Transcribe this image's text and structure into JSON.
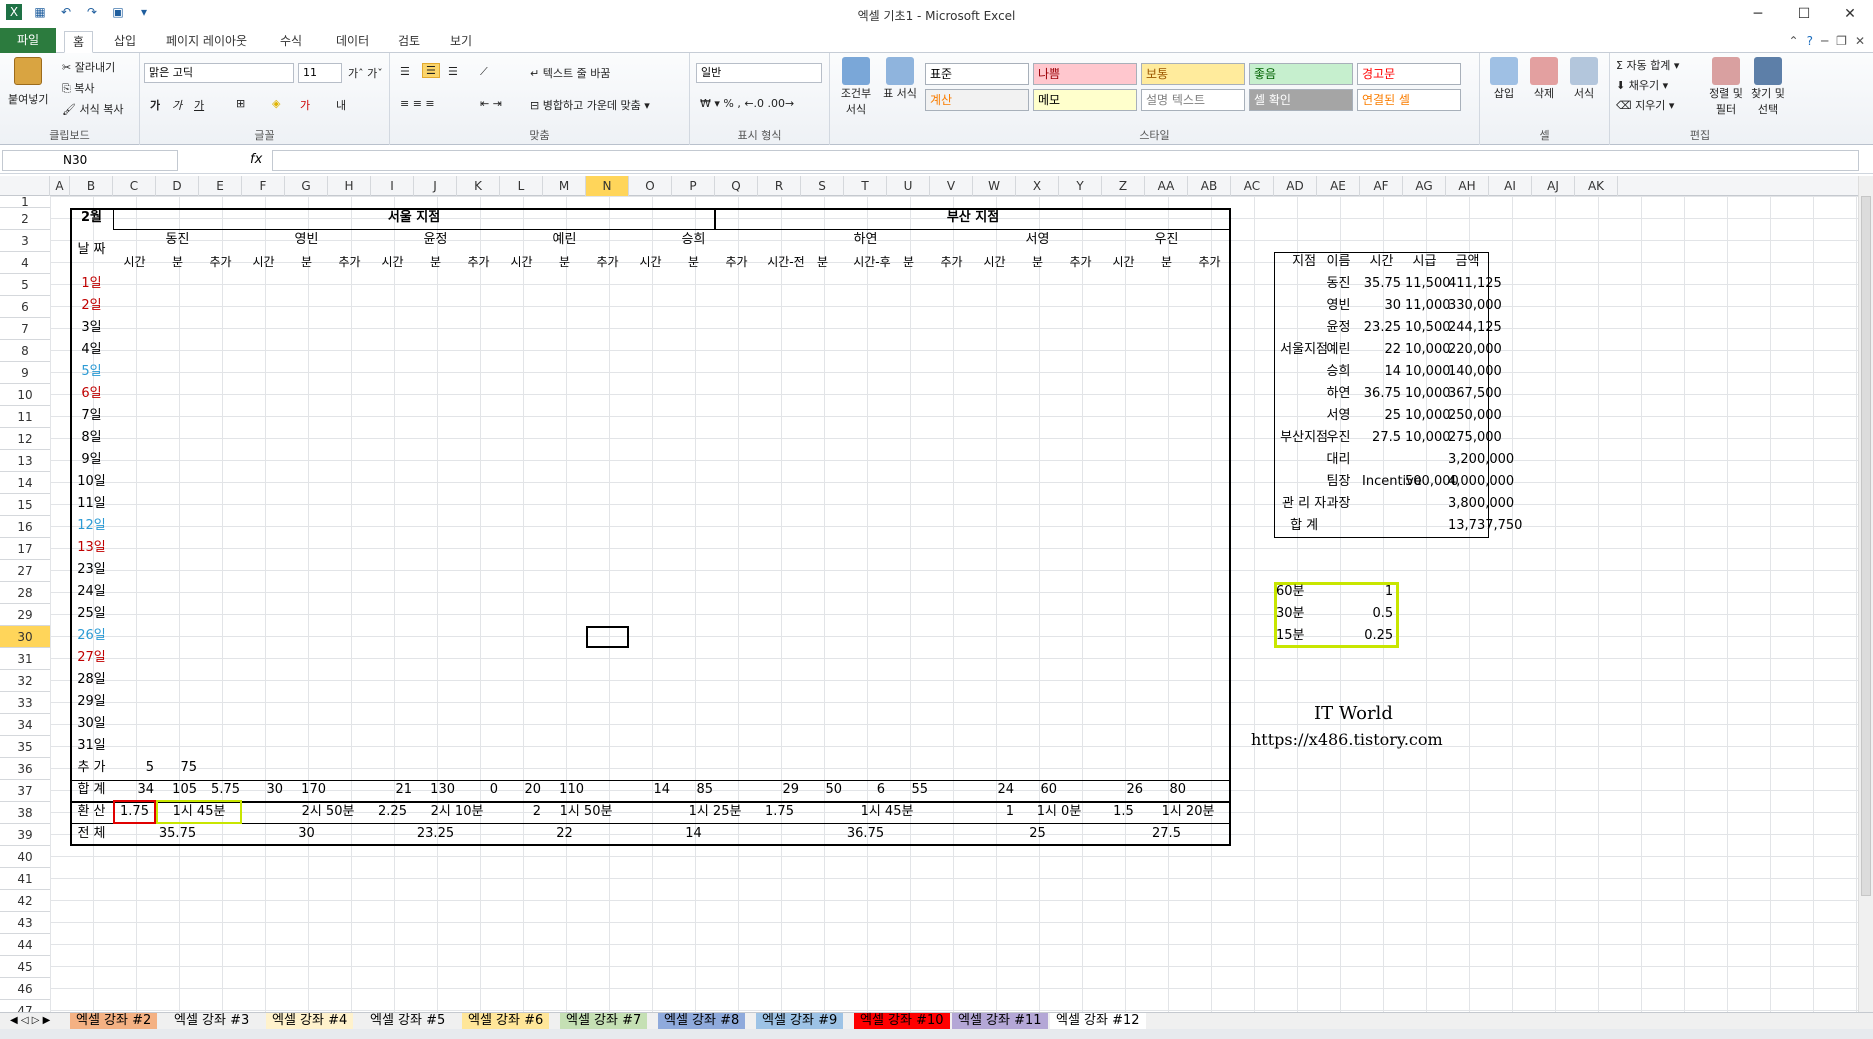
{
  "window": {
    "title": "엑셀 기초1 - Microsoft Excel",
    "min": "─",
    "max": "☐",
    "close": "✕"
  },
  "ribbon_tabs": [
    "파일",
    "홈",
    "삽입",
    "페이지 레이아웃",
    "수식",
    "데이터",
    "검토",
    "보기"
  ],
  "ribbon": {
    "clipboard": {
      "paste": "붙여넣기",
      "cut": "잘라내기",
      "copy": "복사",
      "format_painter": "서식 복사",
      "label": "클립보드"
    },
    "font": {
      "name": "맑은 고딕",
      "size": "11",
      "label": "글꼴"
    },
    "align": {
      "wrap": "텍스트 줄 바꿈",
      "merge": "병합하고 가운데 맞춤",
      "label": "맞춤"
    },
    "number": {
      "format": "일반",
      "label": "표시 형식"
    },
    "styles": {
      "conditional": "조건부 서식",
      "table": "표 서식",
      "cells": [
        {
          "text": "표준",
          "bg": "#ffffff",
          "fg": "#000000"
        },
        {
          "text": "나쁨",
          "bg": "#ffc7ce",
          "fg": "#9c0006"
        },
        {
          "text": "보통",
          "bg": "#ffeb9c",
          "fg": "#9c5700"
        },
        {
          "text": "좋음",
          "bg": "#c6efce",
          "fg": "#006100"
        },
        {
          "text": "경고문",
          "bg": "#ffffff",
          "fg": "#ff0000"
        },
        {
          "text": "계산",
          "bg": "#f2f2f2",
          "fg": "#fa7d00"
        },
        {
          "text": "메모",
          "bg": "#ffffcc",
          "fg": "#000000"
        },
        {
          "text": "설명 텍스트",
          "bg": "#ffffff",
          "fg": "#7f7f7f"
        },
        {
          "text": "셀 확인",
          "bg": "#a5a5a5",
          "fg": "#ffffff"
        },
        {
          "text": "연결된 셀",
          "bg": "#ffffff",
          "fg": "#fa7d00"
        }
      ],
      "label": "스타일"
    },
    "cells": {
      "insert": "삽입",
      "delete": "삭제",
      "format": "서식",
      "label": "셀"
    },
    "edit": {
      "autosum": "자동 합계",
      "fill": "채우기",
      "clear": "지우기",
      "sort": "정렬 및 필터",
      "find": "찾기 및 선택",
      "label": "편집"
    }
  },
  "formula_bar": {
    "name_box": "N30",
    "fx": "fx",
    "formula": ""
  },
  "columns": [
    "A",
    "B",
    "C",
    "D",
    "E",
    "F",
    "G",
    "H",
    "I",
    "J",
    "K",
    "L",
    "M",
    "N",
    "O",
    "P",
    "Q",
    "R",
    "S",
    "T",
    "U",
    "V",
    "W",
    "X",
    "Y",
    "Z",
    "AA",
    "AB",
    "AC",
    "AD",
    "AE",
    "AF",
    "AG",
    "AH",
    "AI",
    "AJ",
    "AK"
  ],
  "rows": [
    "1",
    "2",
    "3",
    "4",
    "5",
    "6",
    "7",
    "8",
    "9",
    "10",
    "11",
    "12",
    "13",
    "14",
    "15",
    "16",
    "17",
    "27",
    "28",
    "29",
    "30",
    "31",
    "32",
    "33",
    "34",
    "35",
    "36",
    "37",
    "38",
    "39",
    "40",
    "41",
    "42",
    "43",
    "44",
    "45",
    "46",
    "47"
  ],
  "selected": {
    "col": "N",
    "row": "30"
  },
  "sheet": {
    "month": "2월",
    "date_header": "날 짜",
    "seoul": "서울 지점",
    "busan": "부산 지점",
    "people": [
      "동진",
      "영빈",
      "윤정",
      "예린",
      "승희",
      "하연",
      "서영",
      "우진"
    ],
    "sub": [
      "시간",
      "분",
      "추가",
      "시간-전",
      "시간-후"
    ],
    "dates": [
      "1일",
      "2일",
      "3일",
      "4일",
      "5일",
      "6일",
      "7일",
      "8일",
      "9일",
      "10일",
      "11일",
      "12일",
      "13일",
      "23일",
      "24일",
      "25일",
      "26일",
      "27일",
      "28일",
      "29일",
      "30일",
      "31일"
    ],
    "footer": {
      "extra": "추 가",
      "sum": "합 계",
      "convert": "환 산",
      "total": "전 체"
    },
    "conv": {
      "dongjin": "1.75",
      "dongjin_min": "1시 45분",
      "yb": "2시 50분",
      "yj": "2.25",
      "yj_min": "2시 10분",
      "yr": "2",
      "yr_min": "1시 50분",
      "sh_min": "1시 25분",
      "hy": "1.75",
      "hy_min": "1시 45분",
      "sy": "1",
      "sy_min": "1시 0분",
      "uj": "1.5",
      "uj_min": "1시 20분"
    },
    "totals": {
      "dj": "35.75",
      "yb": "30",
      "yj": "23.25",
      "yr": "22",
      "sh": "14",
      "hy": "36.75",
      "sy": "25",
      "uj": "27.5"
    },
    "sums": [
      "34",
      "105",
      "5.75",
      "30",
      "170",
      "21",
      "130",
      "0",
      "20",
      "110",
      "14",
      "85",
      "29",
      "50",
      "6",
      "55",
      "24",
      "60",
      "26",
      "80"
    ],
    "extra_row": [
      "5",
      "75"
    ]
  },
  "summary": {
    "headers": [
      "지점",
      "이름",
      "시간",
      "시급",
      "금액"
    ],
    "groups": [
      "서울지점",
      "부산지점",
      "관 리 자",
      "합 계"
    ],
    "rows": [
      [
        "동진",
        "35.75",
        "11,500",
        "411,125"
      ],
      [
        "영빈",
        "30",
        "11,000",
        "330,000"
      ],
      [
        "윤정",
        "23.25",
        "10,500",
        "244,125"
      ],
      [
        "예린",
        "22",
        "10,000",
        "220,000"
      ],
      [
        "승희",
        "14",
        "10,000",
        "140,000"
      ],
      [
        "하연",
        "36.75",
        "10,000",
        "367,500"
      ],
      [
        "서영",
        "25",
        "10,000",
        "250,000"
      ],
      [
        "우진",
        "27.5",
        "10,000",
        "275,000"
      ],
      [
        "대리",
        "",
        "",
        "3,200,000"
      ],
      [
        "팀장",
        "Incentive",
        "500,000",
        "4,000,000"
      ],
      [
        "과장",
        "",
        "",
        "3,800,000"
      ]
    ],
    "total": "13,737,750"
  },
  "conversion_table": [
    [
      "60분",
      "1"
    ],
    [
      "30분",
      "0.5"
    ],
    [
      "15분",
      "0.25"
    ]
  ],
  "watermark": {
    "line1": "IT World",
    "line2": "https://x486.tistory.com"
  },
  "sheet_tabs": [
    "엑셀 강좌 #2",
    "엑셀 강좌 #3",
    "엑셀 강좌 #4",
    "엑셀 강좌 #5",
    "엑셀 강좌 #6",
    "엑셀 강좌 #7",
    "엑셀 강좌 #8",
    "엑셀 강좌 #9",
    "엑셀 강좌 #10",
    "엑셀 강좌 #11",
    "엑셀 강좌 #12"
  ]
}
